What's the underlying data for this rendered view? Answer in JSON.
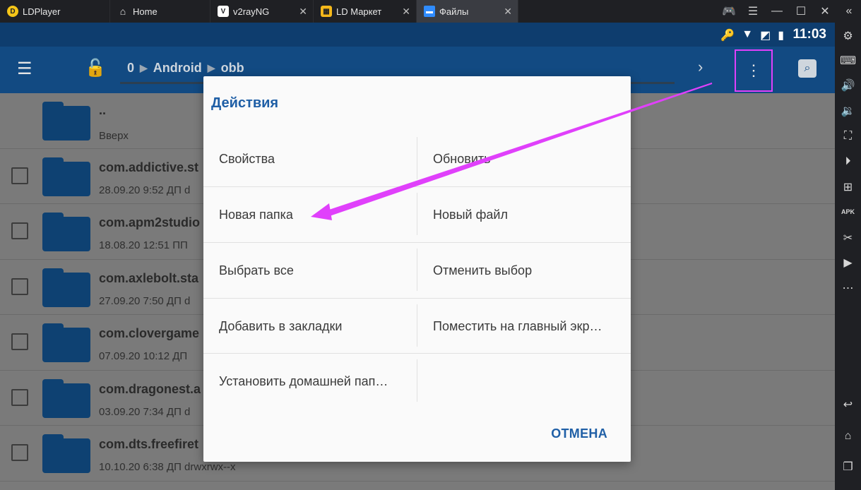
{
  "window": {
    "tabs": [
      {
        "label": "LDPlayer",
        "icon": "ldplayer-logo-icon"
      },
      {
        "label": "Home",
        "icon": "home-icon"
      },
      {
        "label": "v2rayNG",
        "icon": "v2rayng-icon"
      },
      {
        "label": "LD Маркет",
        "icon": "ld-market-icon"
      },
      {
        "label": "Файлы",
        "icon": "folder-icon"
      }
    ],
    "controls": [
      "gamepad-icon",
      "hamburger-icon",
      "minimize-icon",
      "maximize-icon",
      "close-icon",
      "collapse-sidebar-icon"
    ]
  },
  "statusbar": {
    "time": "11:03",
    "icons": [
      "key-icon",
      "wifi-icon",
      "no-sim-icon",
      "battery-charging-icon"
    ]
  },
  "appbar": {
    "breadcrumbs": [
      "0",
      "Android",
      "obb"
    ]
  },
  "files": [
    {
      "name": "..",
      "meta": "Вверх"
    },
    {
      "name": "com.addictive.st",
      "meta": "28.09.20 9:52 ДП  d"
    },
    {
      "name": "com.apm2studio",
      "meta": "18.08.20 12:51 ПП"
    },
    {
      "name": "com.axlebolt.sta",
      "meta": "27.09.20 7:50 ДП  d"
    },
    {
      "name": "com.clovergame",
      "meta": "07.09.20 10:12 ДП"
    },
    {
      "name": "com.dragonest.a",
      "meta": "03.09.20 7:34 ДП  d"
    },
    {
      "name": "com.dts.freefiret",
      "meta": "10.10.20 6:38 ДП  drwxrwx--x"
    }
  ],
  "dialog": {
    "title": "Действия",
    "actions": [
      [
        "Свойства",
        "Обновить"
      ],
      [
        "Новая папка",
        "Новый файл"
      ],
      [
        "Выбрать все",
        "Отменить выбор"
      ],
      [
        "Добавить в закладки",
        "Поместить на главный экр…"
      ],
      [
        "Установить домашней пап…",
        ""
      ]
    ],
    "cancel": "ОТМЕНА"
  },
  "annotation": {
    "color": "#e040fb"
  },
  "sidebar_tools": [
    "settings-icon",
    "keyboard-icon",
    "volume-up-icon",
    "volume-down-icon",
    "screenshot-icon",
    "record-icon",
    "add-app-icon",
    "apk-icon",
    "scissors-icon",
    "video-icon",
    "more-icon",
    "back-icon",
    "home-icon",
    "recents-icon"
  ]
}
